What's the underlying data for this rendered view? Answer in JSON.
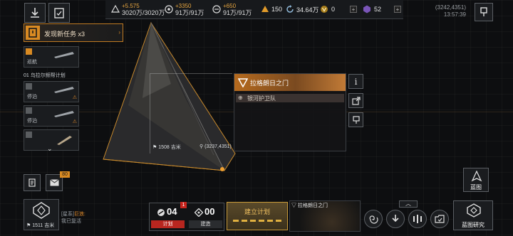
{
  "top_bar": {
    "resources": [
      {
        "delta": "+5.575",
        "value": "3020万/3020万"
      },
      {
        "delta": "+3350",
        "value": "91万/91万"
      },
      {
        "delta": "+650",
        "value": "91万/91万"
      }
    ],
    "fleet_points": "150",
    "credits": "34.64万",
    "currency_a": "0",
    "currency_b": "52",
    "coordinates": "(3242,4351)",
    "time": "13:57:39"
  },
  "mission": {
    "label": "发现新任务 x3"
  },
  "fleet_list": {
    "group_title": "01 乌拉尔频帮计划",
    "cards": [
      {
        "status": "巡航"
      },
      {
        "status": "停泊"
      },
      {
        "status": "停泊"
      },
      {
        "status": ""
      }
    ]
  },
  "target": {
    "title": "拉格朗日之门",
    "subtitle": "银河护卫队",
    "distance": "1508 吉米",
    "coords": "(3237,4351)"
  },
  "mail_badge": "80",
  "player": {
    "distance": "1511 吉米",
    "chat_channel": "[星系]",
    "chat_name": "巨浪:",
    "chat_text": "我已复活"
  },
  "plans": {
    "plan_count": "04",
    "plan_label": "计划",
    "plan_badge": "1",
    "build_count": "00",
    "build_label": "建造",
    "create_label": "建立计划",
    "preview_label": "拉格朗日之门"
  },
  "right_controls": {
    "blueprint_label": "蓝图",
    "blueprint_research_label": "蓝图研究"
  }
}
